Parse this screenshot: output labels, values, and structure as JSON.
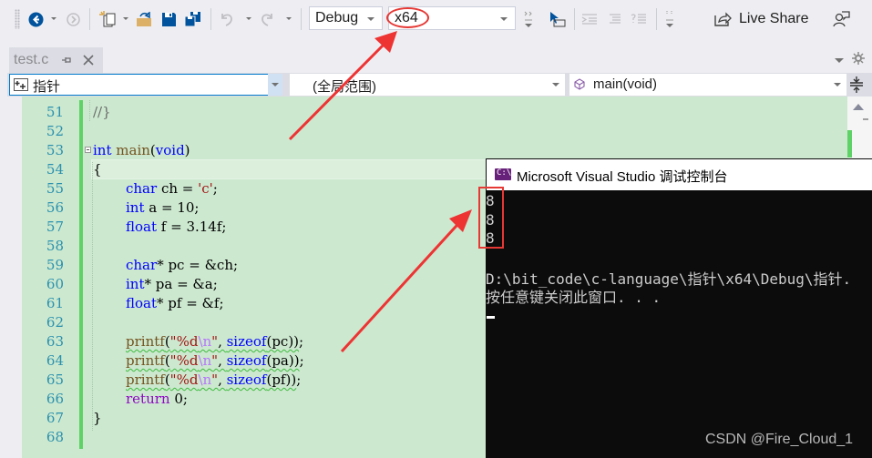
{
  "toolbar": {
    "configuration": "Debug",
    "platform": "x64",
    "live_share_label": "Live Share",
    "icons": [
      "back-icon",
      "forward-icon",
      "new-project-icon",
      "open-file-icon",
      "save-icon",
      "save-all-icon",
      "undo-icon",
      "redo-icon",
      "breakpoint-icon",
      "cursor-select-icon",
      "indent-icon",
      "comment-icon",
      "uncomment-icon",
      "live-share-icon",
      "feedback-icon"
    ]
  },
  "tabs": [
    {
      "label": "test.c",
      "pinned": false,
      "active": true
    }
  ],
  "navbar": {
    "project": "指针",
    "scope": "(全局范围)",
    "member": "main(void)"
  },
  "editor": {
    "lines": [
      {
        "num": "51",
        "text": "//}"
      },
      {
        "num": "52",
        "text": ""
      },
      {
        "num": "53",
        "text": "int main(void)"
      },
      {
        "num": "54",
        "text": "{"
      },
      {
        "num": "55",
        "text": "    char ch = 'c';"
      },
      {
        "num": "56",
        "text": "    int a = 10;"
      },
      {
        "num": "57",
        "text": "    float f = 3.14f;"
      },
      {
        "num": "58",
        "text": ""
      },
      {
        "num": "59",
        "text": "    char* pc = &ch;"
      },
      {
        "num": "60",
        "text": "    int* pa = &a;"
      },
      {
        "num": "61",
        "text": "    float* pf = &f;"
      },
      {
        "num": "62",
        "text": ""
      },
      {
        "num": "63",
        "text": "    printf(\"%d\\n\", sizeof(pc));"
      },
      {
        "num": "64",
        "text": "    printf(\"%d\\n\", sizeof(pa));"
      },
      {
        "num": "65",
        "text": "    printf(\"%d\\n\", sizeof(pf));"
      },
      {
        "num": "66",
        "text": "    return 0;"
      },
      {
        "num": "67",
        "text": "}"
      },
      {
        "num": "68",
        "text": ""
      }
    ],
    "tokens": {
      "kw_int": "int",
      "kw_char": "char",
      "kw_float": "float",
      "kw_return": "return",
      "kw_sizeof": "sizeof",
      "kw_void": "void",
      "fn_main": "main",
      "fn_printf": "printf",
      "str_c": "'c'",
      "str_fmt_open": "\"%d",
      "str_esc": "\\n",
      "str_fmt_close": "\"",
      "comment_51": "//}"
    }
  },
  "console": {
    "title": "Microsoft Visual Studio 调试控制台",
    "icon_label": "C:\\",
    "output": [
      "8",
      "8",
      "8",
      "",
      "D:\\bit_code\\c-language\\指针\\x64\\Debug\\指针.",
      "按任意键关闭此窗口. . ."
    ]
  },
  "watermark": "CSDN @Fire_Cloud_1",
  "annotations": {
    "color": "#e53935"
  }
}
